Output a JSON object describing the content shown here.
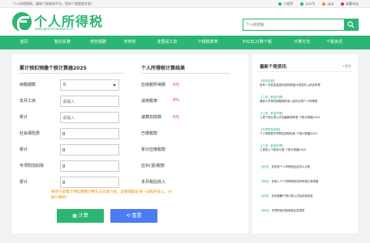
{
  "topbar": {
    "slogan": "个人所得税网，最新个税查询平台，您的个税管理专家！",
    "links": [
      {
        "icon": "mini-program-icon",
        "color": "#2bb673",
        "label": "小程序"
      },
      {
        "icon": "wechat-icon",
        "color": "#2bb673",
        "label": "公众号"
      },
      {
        "icon": "phone-icon",
        "color": "#ff8a00",
        "label": "APP"
      },
      {
        "icon": "bookmark-icon",
        "color": "#e0322b",
        "label": "收藏本站"
      }
    ]
  },
  "header": {
    "logo_name": "个人所得税",
    "logo_url": "www.gerensuodeshui.cn",
    "search_placeholder": "个人所得税"
  },
  "nav": {
    "items": [
      "首页",
      "税后反算",
      "劳务报酬",
      "年终奖",
      "非居民工资",
      "个税税率表",
      "EXCEL计算个税",
      "计算方法",
      "个税资讯"
    ]
  },
  "calculator": {
    "title": "累计预扣预缴个税计算器2025",
    "fields": [
      {
        "label": "纳税期数",
        "value": "0",
        "placeholder": "",
        "type": "select"
      },
      {
        "label": "本月工资",
        "value": "",
        "placeholder": "请输入",
        "type": "input"
      },
      {
        "label": "累计",
        "value": "",
        "placeholder": "请输入",
        "type": "input"
      },
      {
        "label": "社会保险费",
        "value": "0",
        "placeholder": "",
        "type": "input"
      },
      {
        "label": "累计",
        "value": "0",
        "placeholder": "",
        "type": "input"
      },
      {
        "label": "专项附加扣除",
        "value": "0",
        "placeholder": "",
        "type": "input"
      },
      {
        "label": "累计",
        "value": "0",
        "placeholder": "",
        "type": "input"
      }
    ],
    "hint": "悬停于查累计预扣预缴计算方法文章介绍，您缴增额必须一试每月录入，分解计算吧！",
    "calc_label": "计算",
    "reset_label": "重置"
  },
  "results": {
    "title": "个人所得税计算结果",
    "rows": [
      {
        "label": "应纳税所得额",
        "value": "0元"
      },
      {
        "label": "适用税率",
        "value": "0%"
      },
      {
        "label": "速算扣除数",
        "value": "0元"
      },
      {
        "label": "已缴税款",
        "value": ""
      },
      {
        "label": "累计应缴税款",
        "value": ""
      },
      {
        "label": "应补(退)税款",
        "value": ""
      },
      {
        "label": "本月税后收入",
        "value": ""
      }
    ]
  },
  "sidebar": {
    "title": "最新个税资讯",
    "more": "+更多",
    "items": [
      {
        "tag": "【年终奖税】",
        "text": "全年一次性奖金如何选择单独计税或并入综合所得"
      },
      {
        "tag": "【工资、薪金所得】",
        "text": "退休人员再任职取得的收入如何计算个人所得税"
      },
      {
        "tag": "【工资、薪金所得】",
        "text": "工资个税计算公式及最新税率表 个税计算器2025"
      },
      {
        "tag": "【专项附加扣除】",
        "text": "个人所得税专项附加扣除标准 个税计算器2025"
      },
      {
        "tag": "【工资、薪金所得】",
        "text": "工资收入个税怎么算 个税计算器2025"
      },
      {
        "tag": "【资讯】",
        "text": "年终奖个人所得税应该怎么计算"
      },
      {
        "tag": "【资讯】",
        "text": "年收入个人所得税该如何申报汇算清缴"
      },
      {
        "tag": "【资讯】",
        "text": "劳务报酬个税计算公式及扣除标准"
      },
      {
        "tag": "【资讯】",
        "text": "专项附加扣除填报注意事项"
      }
    ]
  }
}
